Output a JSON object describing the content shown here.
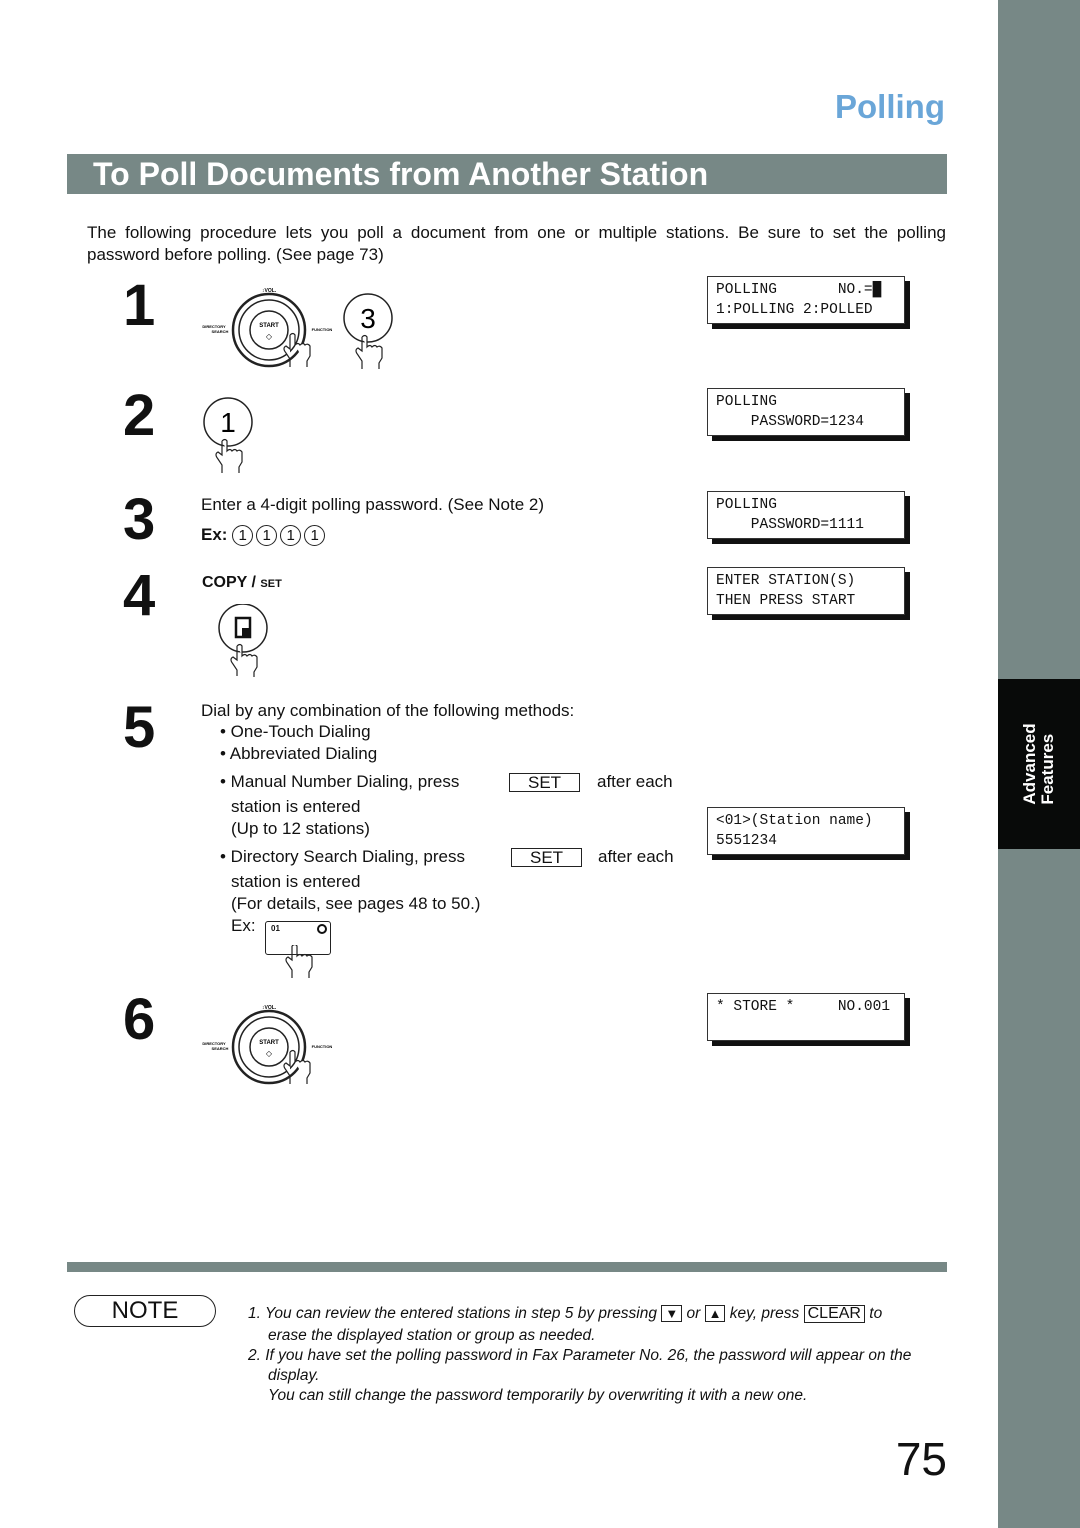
{
  "header": {
    "section": "Polling",
    "title": "To Poll Documents from Another Station"
  },
  "sidebar": {
    "tab_line1": "Advanced",
    "tab_line2": "Features"
  },
  "intro": "The following procedure lets you poll a document from one or multiple stations. Be sure to set the polling password before polling.  (See page 73)",
  "keypad": {
    "vol": "↕VOL.",
    "start": "START",
    "directory": "DIRECTORY",
    "search": "SEARCH",
    "function": "FUNCTION"
  },
  "steps": [
    {
      "num": "1",
      "key": "3",
      "lcd": "POLLING       NO.=█\n1:POLLING 2:POLLED"
    },
    {
      "num": "2",
      "key": "1",
      "lcd": "POLLING\n    PASSWORD=1234"
    },
    {
      "num": "3",
      "text": "Enter a 4-digit polling password. (See Note 2)",
      "ex": "Ex:",
      "digits": [
        "1",
        "1",
        "1",
        "1"
      ],
      "lcd": "POLLING\n    PASSWORD=1111"
    },
    {
      "num": "4",
      "label_copy": "COPY /",
      "label_set": "SET",
      "lcd": "ENTER STATION(S)\nTHEN PRESS START"
    },
    {
      "num": "5",
      "text": "Dial by any combination of the following methods:",
      "b1": "• One-Touch Dialing",
      "b2": "• Abbreviated Dialing",
      "b3a": "• Manual  Number  Dialing,  press",
      "b3b": "after  each",
      "b3c": "station is entered",
      "b3d": "(Up to 12 stations)",
      "b4a": "• Directory  Search  Dialing,  press",
      "b4b": "after  each",
      "b4c": "station is entered",
      "b4d": "(For details, see pages 48 to 50.)",
      "ex": "Ex:",
      "onetouch": "01",
      "set": "SET",
      "lcd": "<01>(Station name)\n5551234"
    },
    {
      "num": "6",
      "lcd": "* STORE *     NO.001"
    }
  ],
  "note": {
    "label": "NOTE",
    "n1a": "1.  You can review the entered stations in step 5 by pressing",
    "or": "or",
    "n1b": "key, press",
    "clear": "CLEAR",
    "n1c": "to",
    "n1d": "erase the displayed station or group as needed.",
    "n2a": "2.  If you have set the polling password in Fax Parameter No. 26, the password will appear on the",
    "n2b": "display.",
    "n2c": "You can still change the password temporarily by overwriting it with a new one.",
    "down": "▼",
    "up": "▲"
  },
  "page_number": "75"
}
